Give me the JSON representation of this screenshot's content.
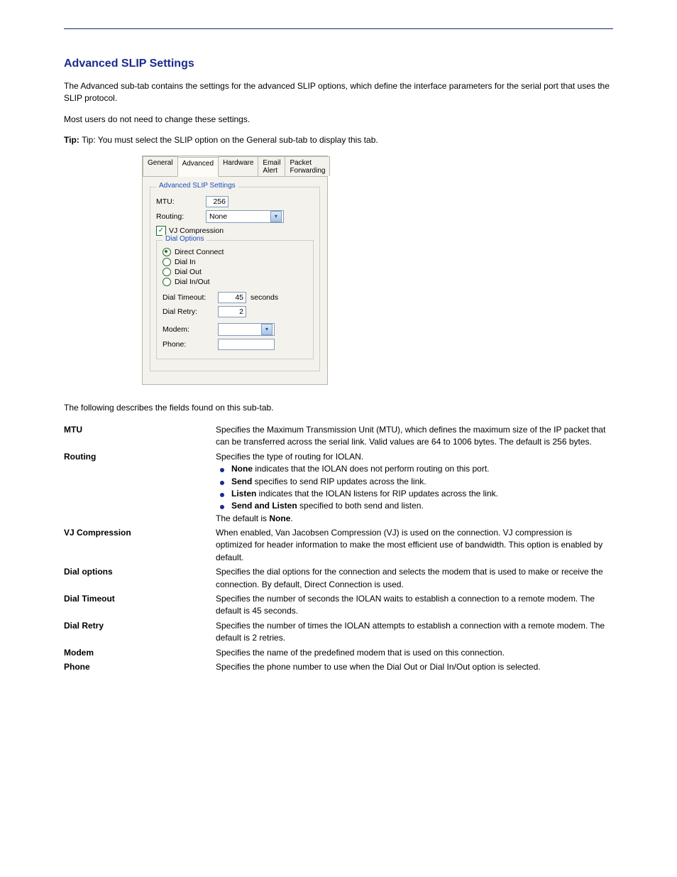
{
  "heading": "Advanced SLIP Settings",
  "intro": [
    "The Advanced sub-tab contains the settings for the advanced SLIP options, which define the interface parameters for the serial port that uses the SLIP protocol.",
    "Most users do not need to change these settings.",
    "Tip: You must select the SLIP option on the General sub-tab to display this tab."
  ],
  "tabs": {
    "general": "General",
    "advanced": "Advanced",
    "hardware": "Hardware",
    "email": "Email Alert",
    "packet": "Packet Forwarding"
  },
  "group": {
    "slip_legend": "Advanced SLIP Settings",
    "mtu_label": "MTU:",
    "mtu_value": "256",
    "routing_label": "Routing:",
    "routing_value": "None",
    "vj_label": "VJ Compression",
    "dial_legend": "Dial Options",
    "opt_direct": "Direct Connect",
    "opt_in": "Dial In",
    "opt_out": "Dial Out",
    "opt_inout": "Dial In/Out",
    "timeout_label": "Dial Timeout:",
    "timeout_value": "45",
    "timeout_suffix": "seconds",
    "retry_label": "Dial Retry:",
    "retry_value": "2",
    "modem_label": "Modem:",
    "modem_value": "",
    "phone_label": "Phone:",
    "phone_value": ""
  },
  "fields": {
    "mtu": {
      "k": "MTU",
      "v": "Specifies the Maximum Transmission Unit (MTU), which defines the maximum size of the IP packet that can be transferred across the serial link. Valid values are 64 to 1006 bytes. The default is 256 bytes."
    },
    "routing": {
      "k": "Routing",
      "v": [
        "Specifies the type of routing for IOLAN.",
        "None indicates that the IOLAN does not perform routing on this port.",
        "Send specifies to send RIP updates across the link.",
        "Listen indicates that the IOLAN listens for RIP updates across the link.",
        "Send and Listen specified to both send and listen.",
        "The default is None."
      ]
    },
    "vj": {
      "k": "VJ Compression",
      "v": "When enabled, Van Jacobsen Compression (VJ) is used on the connection. VJ compression is optimized for header information to make the most efficient use of bandwidth. This option is enabled by default."
    },
    "dial": {
      "k": "Dial options",
      "v": "Specifies the dial options for the connection and selects the modem that is used to make or receive the connection. By default, Direct Connection is used."
    },
    "timeout": {
      "k": "Dial Timeout",
      "v": "Specifies the number of seconds the IOLAN waits to establish a connection to a remote modem. The default is 45 seconds."
    },
    "retry": {
      "k": "Dial Retry",
      "v": "Specifies the number of times the IOLAN attempts to establish a connection with a remote modem. The default is 2 retries."
    },
    "modem": {
      "k": "Modem",
      "v": "Specifies the name of the predefined modem that is used on this connection."
    },
    "phone": {
      "k": "Phone",
      "v": "Specifies the phone number to use when the Dial Out or Dial In/Out option is selected."
    }
  }
}
